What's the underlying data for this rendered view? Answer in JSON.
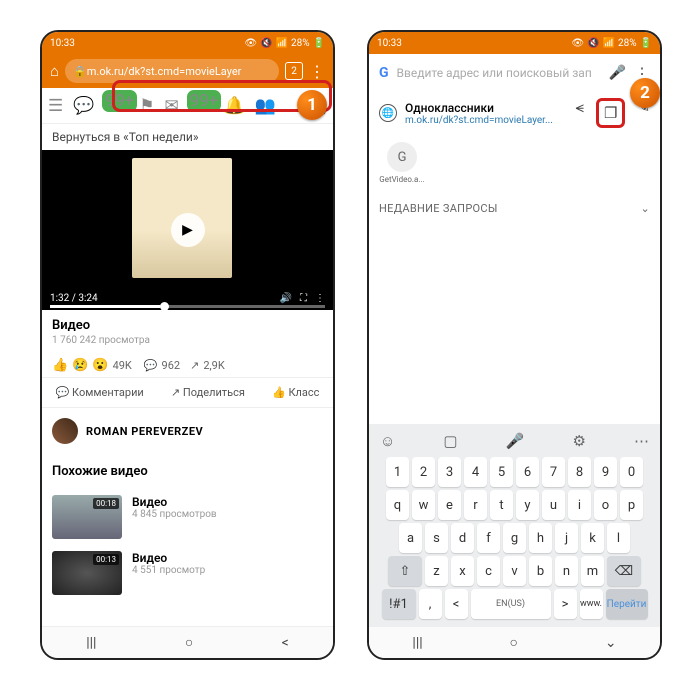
{
  "status": {
    "time": "10:33",
    "eye": "👁",
    "vol": "🔇",
    "wifi": "📶",
    "batt_pct": "28%",
    "batt": "🔋"
  },
  "p1": {
    "url": "m.ok.ru/dk?st.cmd=movieLayer",
    "tabcount": "2",
    "badges": {
      "a": "99+",
      "b": "99+"
    },
    "backtop": "Вернуться в «Топ недели»",
    "time": "1:32 / 3:24",
    "title": "Видео",
    "views": "1 760 242 просмотра",
    "reacts": "49K",
    "comments": "962",
    "shares": "2,9K",
    "act_comment": "Комментарии",
    "act_share": "Поделиться",
    "act_klass": "Класс",
    "author": "ROMAN PEREVERZEV",
    "related_h": "Похожие видео",
    "rel": [
      {
        "dur": "00:18",
        "title": "Видео",
        "views": "4 845 просмотров"
      },
      {
        "dur": "00:13",
        "title": "Видео",
        "views": "4 551 просмотр"
      }
    ]
  },
  "p2": {
    "search_ph": "Введите адрес или поисковый зап",
    "tab_title": "Одноклассники",
    "tab_url": "m.ok.ru/dk?st.cmd=movieLayer...",
    "qs_label": "GetVideo.a...",
    "qs_letter": "G",
    "recent": "НЕДАВНИЕ ЗАПРОСЫ",
    "kbd": {
      "nums": [
        "1",
        "2",
        "3",
        "4",
        "5",
        "6",
        "7",
        "8",
        "9",
        "0"
      ],
      "r1": [
        "q",
        "w",
        "e",
        "r",
        "t",
        "y",
        "u",
        "i",
        "o",
        "p"
      ],
      "r2": [
        "a",
        "s",
        "d",
        "f",
        "g",
        "h",
        "j",
        "k",
        "l"
      ],
      "r3": [
        "z",
        "x",
        "c",
        "v",
        "b",
        "n",
        "m"
      ],
      "sym": "!#1",
      "lang": "EN(US)",
      "www": "www.",
      "go": "Перейти"
    }
  },
  "marks": {
    "one": "1",
    "two": "2"
  }
}
